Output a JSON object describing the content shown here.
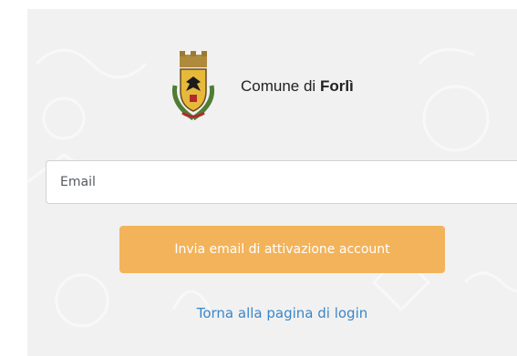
{
  "brand": {
    "prefix": "Comune di",
    "name": "Forlì"
  },
  "form": {
    "email_placeholder": "Email",
    "email_value": "",
    "submit_label": "Invia email di attivazione account"
  },
  "links": {
    "back_to_login": "Torna alla pagina di login"
  },
  "colors": {
    "background_panel": "#f1f1f1",
    "button": "#f3b35a",
    "link": "#3a86c8"
  },
  "icons": {
    "crest": "city-crest-icon"
  }
}
